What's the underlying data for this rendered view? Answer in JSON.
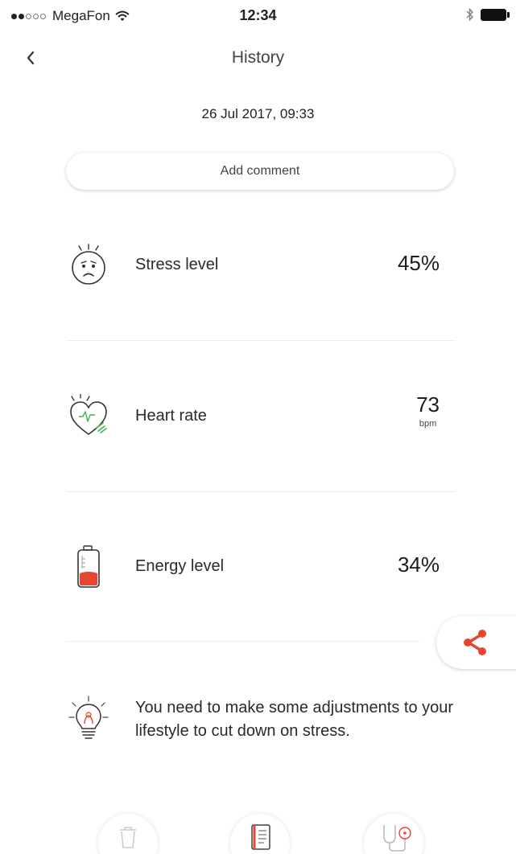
{
  "status_bar": {
    "carrier": "MegaFon",
    "time": "12:34"
  },
  "nav": {
    "title": "History"
  },
  "record": {
    "date": "26 Jul 2017, 09:33",
    "add_comment_label": "Add comment"
  },
  "metrics": [
    {
      "label": "Stress level",
      "value": "45%",
      "icon": "worried-face-icon"
    },
    {
      "label": "Heart rate",
      "value": "73",
      "unit": "bpm",
      "icon": "heart-pulse-icon"
    },
    {
      "label": "Energy level",
      "value": "34%",
      "icon": "battery-level-icon"
    }
  ],
  "tip": {
    "text": "You need to make some adjustments to your lifestyle to cut down on stress.",
    "icon": "lightbulb-icon"
  },
  "actions": [
    {
      "name": "delete",
      "icon": "trash-icon"
    },
    {
      "name": "notes",
      "icon": "notebook-icon"
    },
    {
      "name": "measure",
      "icon": "stethoscope-icon"
    }
  ],
  "colors": {
    "accent": "#e8452e",
    "heart_green": "#3cb34a",
    "divider": "#ececec",
    "text": "#2a2a2a"
  }
}
